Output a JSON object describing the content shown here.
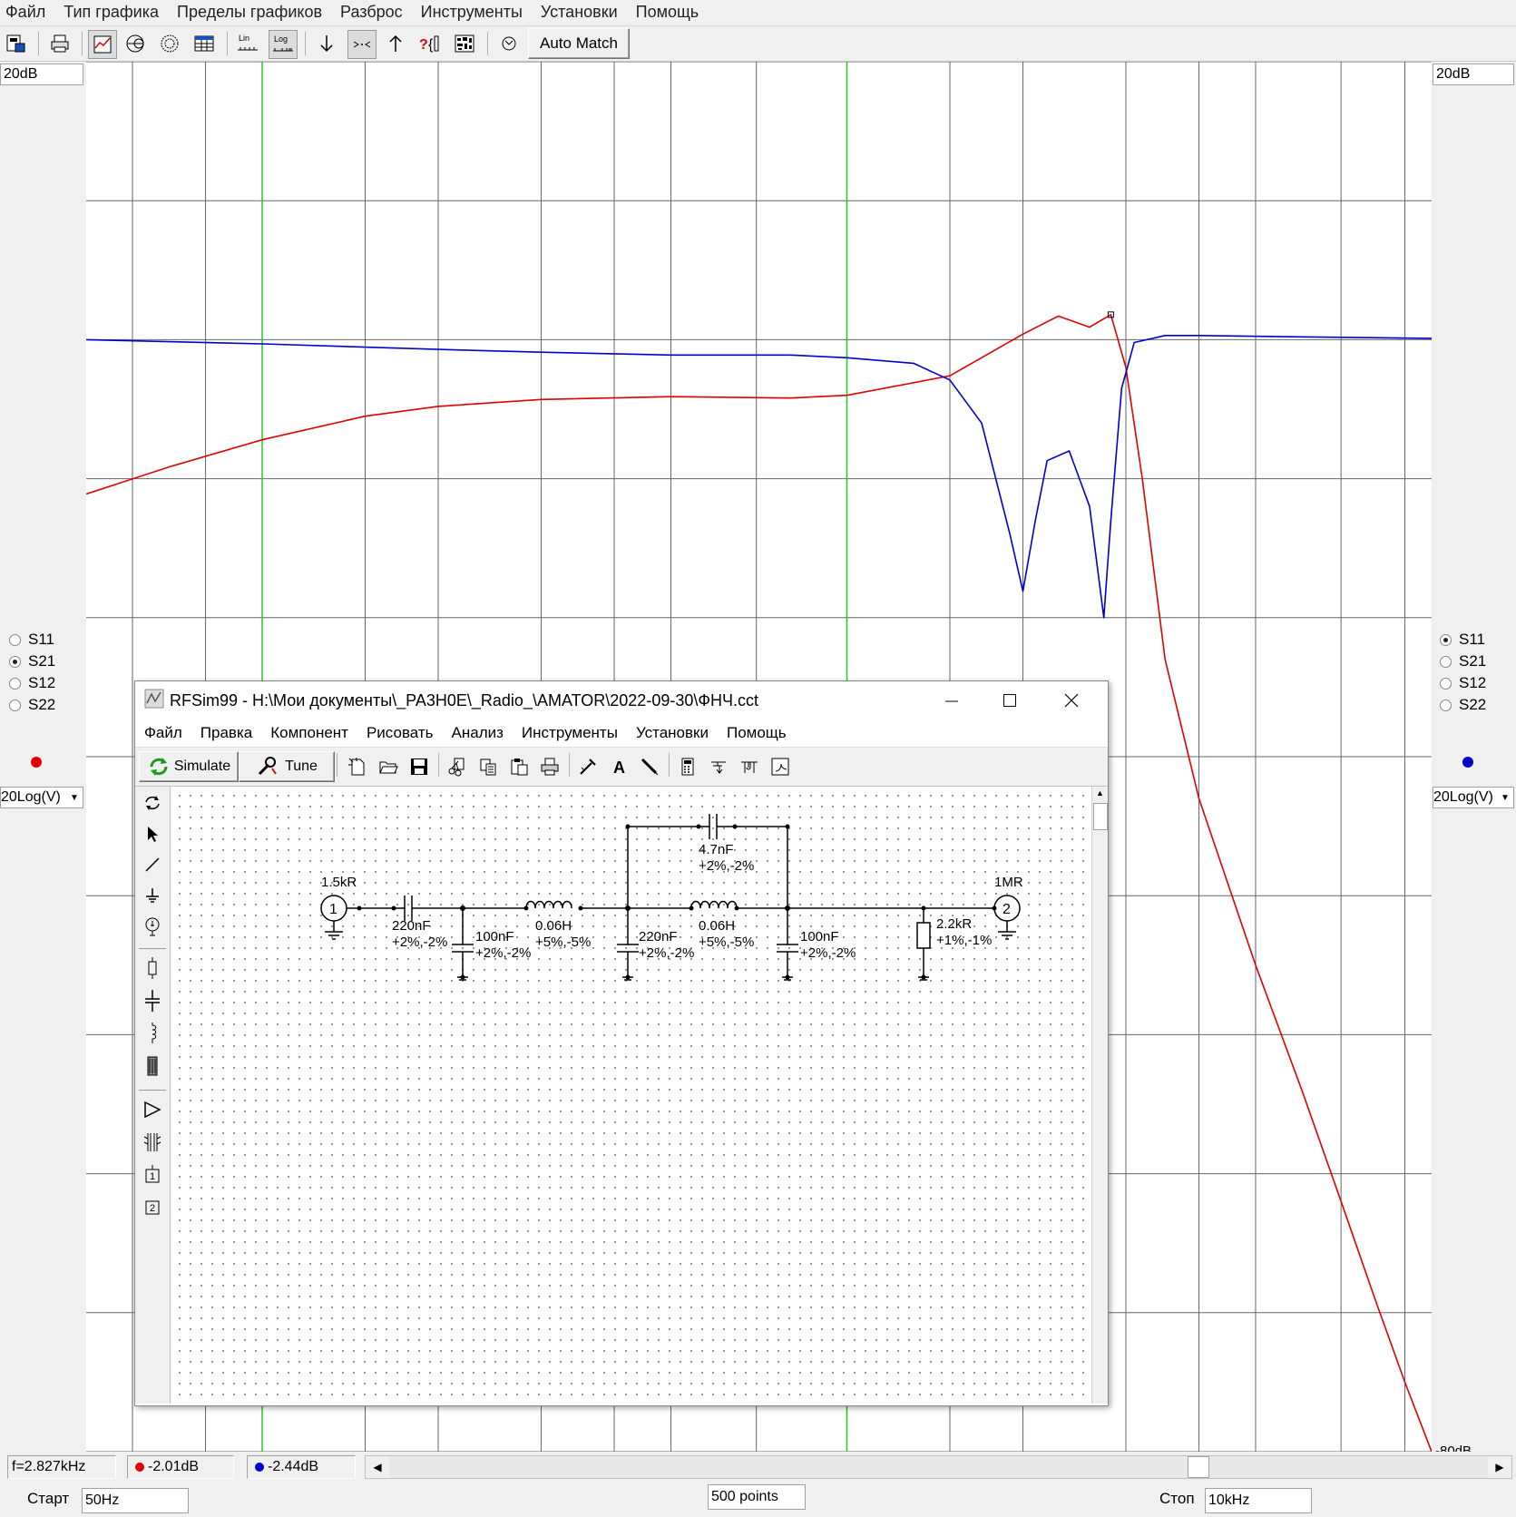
{
  "menubar": {
    "items": [
      "Файл",
      "Тип графика",
      "Пределы графиков",
      "Разброс",
      "Инструменты",
      "Установки",
      "Помощь"
    ]
  },
  "toolbar": {
    "icons": [
      "save-report-icon",
      "print-icon",
      "rect-plot-icon",
      "smith-chart-icon",
      "polar-plot-icon",
      "table-icon",
      "lin-scale-icon",
      "log-scale-icon",
      "marker-down-icon",
      "marker-between-icon",
      "marker-up-icon",
      "help-marker-icon",
      "tolerance-icon",
      "refresh-icon"
    ],
    "lin_label": "Lin",
    "log_label": "Log",
    "auto_match_label": "Auto Match"
  },
  "left_panel": {
    "top_value": "20dB",
    "radios": [
      {
        "label": "S11",
        "checked": false
      },
      {
        "label": "S21",
        "checked": true
      },
      {
        "label": "S12",
        "checked": false
      },
      {
        "label": "S22",
        "checked": false
      }
    ],
    "dot_color": "#e00000",
    "mode_value": "20Log(V)"
  },
  "right_panel": {
    "top_value": "20dB",
    "radios": [
      {
        "label": "S11",
        "checked": true
      },
      {
        "label": "S21",
        "checked": false
      },
      {
        "label": "S12",
        "checked": false
      },
      {
        "label": "S22",
        "checked": false
      }
    ],
    "dot_color": "#0000cc",
    "mode_value": "20Log(V)",
    "bottom_value": "-80dB"
  },
  "chart_data": {
    "type": "line",
    "x_scale": "log",
    "xlim_hz": [
      50,
      10000
    ],
    "ylim_db": [
      -80,
      20
    ],
    "y_gridlines_db": [
      20,
      10,
      0,
      -10,
      -20,
      -30,
      -40,
      -50,
      -60,
      -70,
      -80
    ],
    "grid": true,
    "series": [
      {
        "trace": "S21",
        "color": "#e00000",
        "x_hz": [
          50,
          70,
          100,
          150,
          200,
          300,
          500,
          800,
          1000,
          1500,
          2000,
          2300,
          2600,
          2827,
          3000,
          3200,
          3500,
          4000,
          5000,
          6000,
          7000,
          8000,
          9000,
          10000
        ],
        "y_db": [
          -11.1,
          -9.1,
          -7.2,
          -5.5,
          -4.8,
          -4.3,
          -4.1,
          -4.2,
          -4.0,
          -2.6,
          0.4,
          1.7,
          0.9,
          1.8,
          -2.0,
          -10.0,
          -23.0,
          -33.0,
          -45.0,
          -54.0,
          -62.0,
          -69.0,
          -75.0,
          -80.0
        ]
      },
      {
        "trace": "S11",
        "color": "#0000cc",
        "x_hz": [
          50,
          100,
          200,
          300,
          500,
          800,
          1000,
          1300,
          1500,
          1700,
          1900,
          2000,
          2100,
          2200,
          2400,
          2600,
          2750,
          2827,
          2950,
          3100,
          3500,
          4000,
          6000,
          10000
        ],
        "y_db": [
          0.0,
          -0.3,
          -0.7,
          -0.9,
          -1.1,
          -1.1,
          -1.3,
          -1.7,
          -2.9,
          -6.0,
          -14.0,
          -18.1,
          -13.0,
          -8.7,
          -8.0,
          -12.0,
          -20.0,
          -13.0,
          -3.5,
          -0.2,
          0.3,
          0.3,
          0.2,
          0.1
        ]
      }
    ],
    "cursors_hz": [
      100,
      1000
    ]
  },
  "status": {
    "frequency": "f=2.827kHz",
    "red_value": "-2.01dB",
    "blue_value": "-2.44dB",
    "start_label": "Старт",
    "start_value": "50Hz",
    "points_value": "500 points",
    "stop_label": "Стоп",
    "stop_value": "10kHz"
  },
  "window": {
    "title": "RFSim99 - H:\\Мои документы\\_PA3H0E\\_Radio_\\AMATOR\\2022-09-30\\ФНЧ.cct",
    "menu": [
      "Файл",
      "Правка",
      "Компонент",
      "Рисовать",
      "Анализ",
      "Инструменты",
      "Установки",
      "Помощь"
    ],
    "simulate_label": "Simulate",
    "tune_label": "Tune",
    "schematic": {
      "port1": {
        "number": "1",
        "impedance": "1.5kR"
      },
      "port2": {
        "number": "2",
        "impedance": "1MR"
      },
      "c_series": {
        "value": "220nF",
        "tol": "+2%,-2%"
      },
      "c_shunt1": {
        "value": "100nF",
        "tol": "+2%,-2%"
      },
      "l1": {
        "value": "0.06H",
        "tol": "+5%,-5%"
      },
      "c_shunt2": {
        "value": "220nF",
        "tol": "+2%,-2%"
      },
      "l2": {
        "value": "0.06H",
        "tol": "+5%,-5%"
      },
      "c_bridge": {
        "value": "4.7nF",
        "tol": "+2%,-2%"
      },
      "c_shunt3": {
        "value": "100nF",
        "tol": "+2%,-2%"
      },
      "r_shunt": {
        "value": "2.2kR",
        "tol": "+1%,-1%"
      }
    }
  }
}
